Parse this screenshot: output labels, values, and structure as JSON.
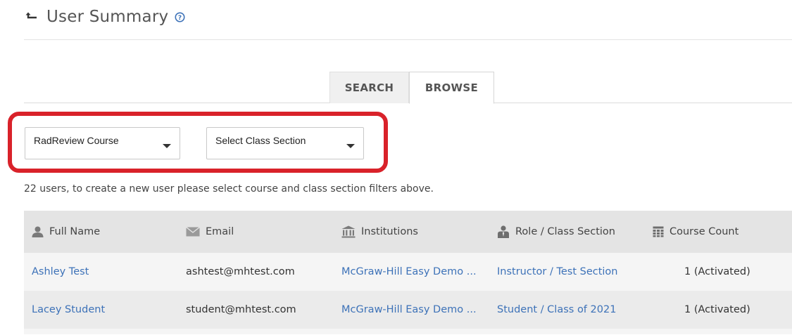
{
  "header": {
    "title": "User Summary"
  },
  "tabs": [
    {
      "label": "SEARCH",
      "active": false
    },
    {
      "label": "BROWSE",
      "active": true
    }
  ],
  "filters": {
    "course": {
      "selected": "RadReview Course"
    },
    "class_section": {
      "selected": "Select Class Section"
    }
  },
  "info_text": "22 users, to create a new user please select course and class section filters above.",
  "table": {
    "columns": [
      {
        "label": "Full Name",
        "icon": "user-icon"
      },
      {
        "label": "Email",
        "icon": "envelope-icon"
      },
      {
        "label": "Institutions",
        "icon": "institution-icon"
      },
      {
        "label": "Role / Class Section",
        "icon": "role-icon"
      },
      {
        "label": "Course Count",
        "icon": "calendar-grid-icon"
      }
    ],
    "rows": [
      {
        "full_name": "Ashley Test",
        "email": "ashtest@mhtest.com",
        "institution": "McGraw-Hill Easy Demo ...",
        "role_section": "Instructor / Test Section",
        "course_count": "1 (Activated)"
      },
      {
        "full_name": "Lacey Student",
        "email": "student@mhtest.com",
        "institution": "McGraw-Hill Easy Demo ...",
        "role_section": "Student / Class of 2021",
        "course_count": "1 (Activated)"
      }
    ]
  },
  "colors": {
    "link": "#3d72b8",
    "highlight": "#d9222a",
    "header_bg": "#e4e4e4"
  }
}
